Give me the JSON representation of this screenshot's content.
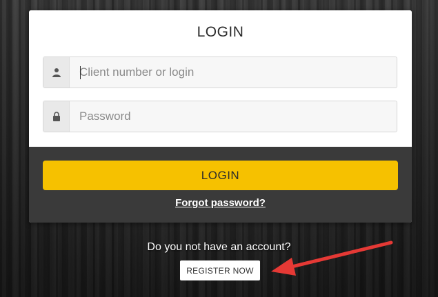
{
  "login_card": {
    "title": "LOGIN",
    "login_field": {
      "placeholder": "Client number or login",
      "value": "",
      "icon": "user-icon"
    },
    "password_field": {
      "placeholder": "Password",
      "value": "",
      "icon": "lock-icon"
    },
    "login_button_label": "LOGIN",
    "forgot_password_label": "Forgot password?"
  },
  "registration": {
    "prompt_text": "Do you not have an account?",
    "register_button_label": "REGISTER NOW"
  },
  "colors": {
    "accent": "#f6c100",
    "card_footer": "#3a3a3a",
    "annotation_arrow": "#e53935"
  }
}
